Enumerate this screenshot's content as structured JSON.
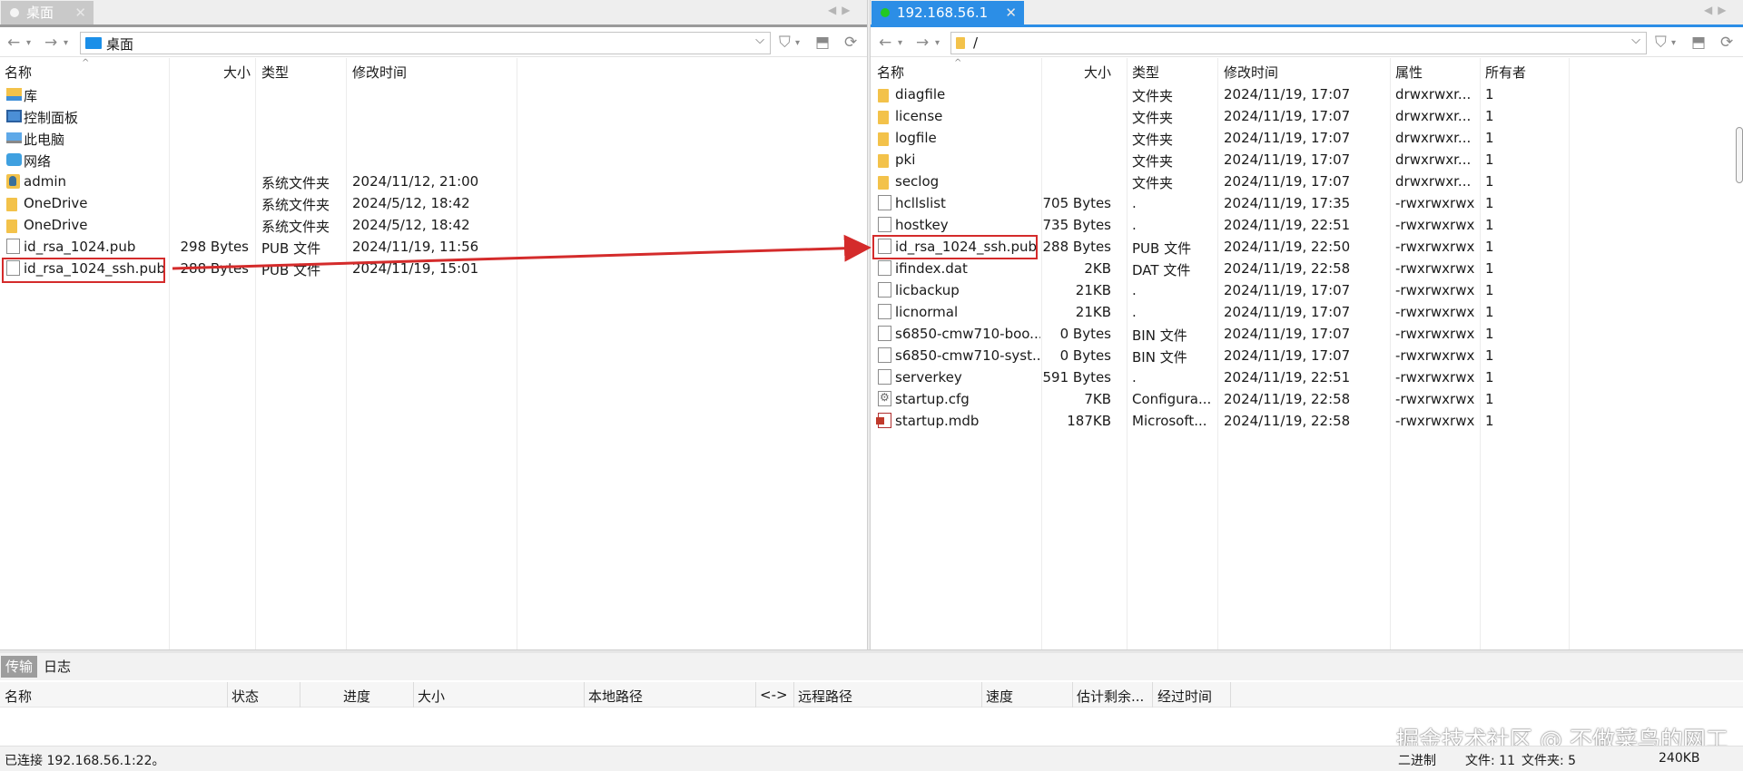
{
  "left": {
    "tab_label": "桌面",
    "path": "桌面",
    "columns": [
      "名称",
      "大小",
      "类型",
      "修改时间"
    ],
    "rows": [
      {
        "icon": "library-icon",
        "name": "库",
        "size": "",
        "type": "",
        "modified": ""
      },
      {
        "icon": "control-panel-icon",
        "name": "控制面板",
        "size": "",
        "type": "",
        "modified": ""
      },
      {
        "icon": "computer-icon",
        "name": "此电脑",
        "size": "",
        "type": "",
        "modified": ""
      },
      {
        "icon": "network-icon",
        "name": "网络",
        "size": "",
        "type": "",
        "modified": ""
      },
      {
        "icon": "user-folder-icon",
        "name": "admin",
        "size": "",
        "type": "系统文件夹",
        "modified": "2024/11/12, 21:00"
      },
      {
        "icon": "folder-icon",
        "name": "OneDrive",
        "size": "",
        "type": "系统文件夹",
        "modified": "2024/5/12, 18:42"
      },
      {
        "icon": "folder-icon",
        "name": "OneDrive",
        "size": "",
        "type": "系统文件夹",
        "modified": "2024/5/12, 18:42"
      },
      {
        "icon": "file-icon",
        "name": "id_rsa_1024.pub",
        "size": "298 Bytes",
        "type": "PUB 文件",
        "modified": "2024/11/19, 11:56"
      },
      {
        "icon": "file-icon",
        "name": "id_rsa_1024_ssh.pub",
        "size": "288 Bytes",
        "type": "PUB 文件",
        "modified": "2024/11/19, 15:01"
      }
    ]
  },
  "right": {
    "tab_label": "192.168.56.1",
    "path": "/",
    "columns": [
      "名称",
      "大小",
      "类型",
      "修改时间",
      "属性",
      "所有者"
    ],
    "rows": [
      {
        "icon": "folder-icon",
        "name": "diagfile",
        "size": "",
        "type": "文件夹",
        "modified": "2024/11/19, 17:07",
        "attr": "drwxrwxr...",
        "owner": "1"
      },
      {
        "icon": "folder-icon",
        "name": "license",
        "size": "",
        "type": "文件夹",
        "modified": "2024/11/19, 17:07",
        "attr": "drwxrwxr...",
        "owner": "1"
      },
      {
        "icon": "folder-icon",
        "name": "logfile",
        "size": "",
        "type": "文件夹",
        "modified": "2024/11/19, 17:07",
        "attr": "drwxrwxr...",
        "owner": "1"
      },
      {
        "icon": "folder-icon",
        "name": "pki",
        "size": "",
        "type": "文件夹",
        "modified": "2024/11/19, 17:07",
        "attr": "drwxrwxr...",
        "owner": "1"
      },
      {
        "icon": "folder-icon",
        "name": "seclog",
        "size": "",
        "type": "文件夹",
        "modified": "2024/11/19, 17:07",
        "attr": "drwxrwxr...",
        "owner": "1"
      },
      {
        "icon": "file-icon",
        "name": "hcllslist",
        "size": "705 Bytes",
        "type": ".",
        "modified": "2024/11/19, 17:35",
        "attr": "-rwxrwxrwx",
        "owner": "1"
      },
      {
        "icon": "file-icon",
        "name": "hostkey",
        "size": "735 Bytes",
        "type": ".",
        "modified": "2024/11/19, 22:51",
        "attr": "-rwxrwxrwx",
        "owner": "1"
      },
      {
        "icon": "file-icon",
        "name": "id_rsa_1024_ssh.pub",
        "size": "288 Bytes",
        "type": "PUB 文件",
        "modified": "2024/11/19, 22:50",
        "attr": "-rwxrwxrwx",
        "owner": "1"
      },
      {
        "icon": "file-icon",
        "name": "ifindex.dat",
        "size": "2KB",
        "type": "DAT 文件",
        "modified": "2024/11/19, 22:58",
        "attr": "-rwxrwxrwx",
        "owner": "1"
      },
      {
        "icon": "file-icon",
        "name": "licbackup",
        "size": "21KB",
        "type": ".",
        "modified": "2024/11/19, 17:07",
        "attr": "-rwxrwxrwx",
        "owner": "1"
      },
      {
        "icon": "file-icon",
        "name": "licnormal",
        "size": "21KB",
        "type": ".",
        "modified": "2024/11/19, 17:07",
        "attr": "-rwxrwxrwx",
        "owner": "1"
      },
      {
        "icon": "file-icon",
        "name": "s6850-cmw710-boo...",
        "size": "0 Bytes",
        "type": "BIN 文件",
        "modified": "2024/11/19, 17:07",
        "attr": "-rwxrwxrwx",
        "owner": "1"
      },
      {
        "icon": "file-icon",
        "name": "s6850-cmw710-syst...",
        "size": "0 Bytes",
        "type": "BIN 文件",
        "modified": "2024/11/19, 17:07",
        "attr": "-rwxrwxrwx",
        "owner": "1"
      },
      {
        "icon": "file-icon",
        "name": "serverkey",
        "size": "591 Bytes",
        "type": ".",
        "modified": "2024/11/19, 22:51",
        "attr": "-rwxrwxrwx",
        "owner": "1"
      },
      {
        "icon": "config-file-icon",
        "name": "startup.cfg",
        "size": "7KB",
        "type": "Configura...",
        "modified": "2024/11/19, 22:58",
        "attr": "-rwxrwxrwx",
        "owner": "1"
      },
      {
        "icon": "access-db-icon",
        "name": "startup.mdb",
        "size": "187KB",
        "type": "Microsoft...",
        "modified": "2024/11/19, 22:58",
        "attr": "-rwxrwxrwx",
        "owner": "1"
      }
    ]
  },
  "queue": {
    "tabs": [
      "传输",
      "日志"
    ],
    "columns": [
      "名称",
      "状态",
      "进度",
      "大小",
      "本地路径",
      "<->",
      "远程路径",
      "速度",
      "估计剩余...",
      "经过时间"
    ]
  },
  "status": {
    "connection": "已连接 192.168.56.1:22。",
    "mode": "二进制",
    "files": "文件: 11",
    "folders": "文件夹: 5",
    "total": "240KB"
  },
  "watermark": "掘金技术社区 @ 不做菜鸟的网工",
  "colors": {
    "accent": "#2c8ee6",
    "highlight": "#d42b2b",
    "connected_dot": "#22c922"
  }
}
